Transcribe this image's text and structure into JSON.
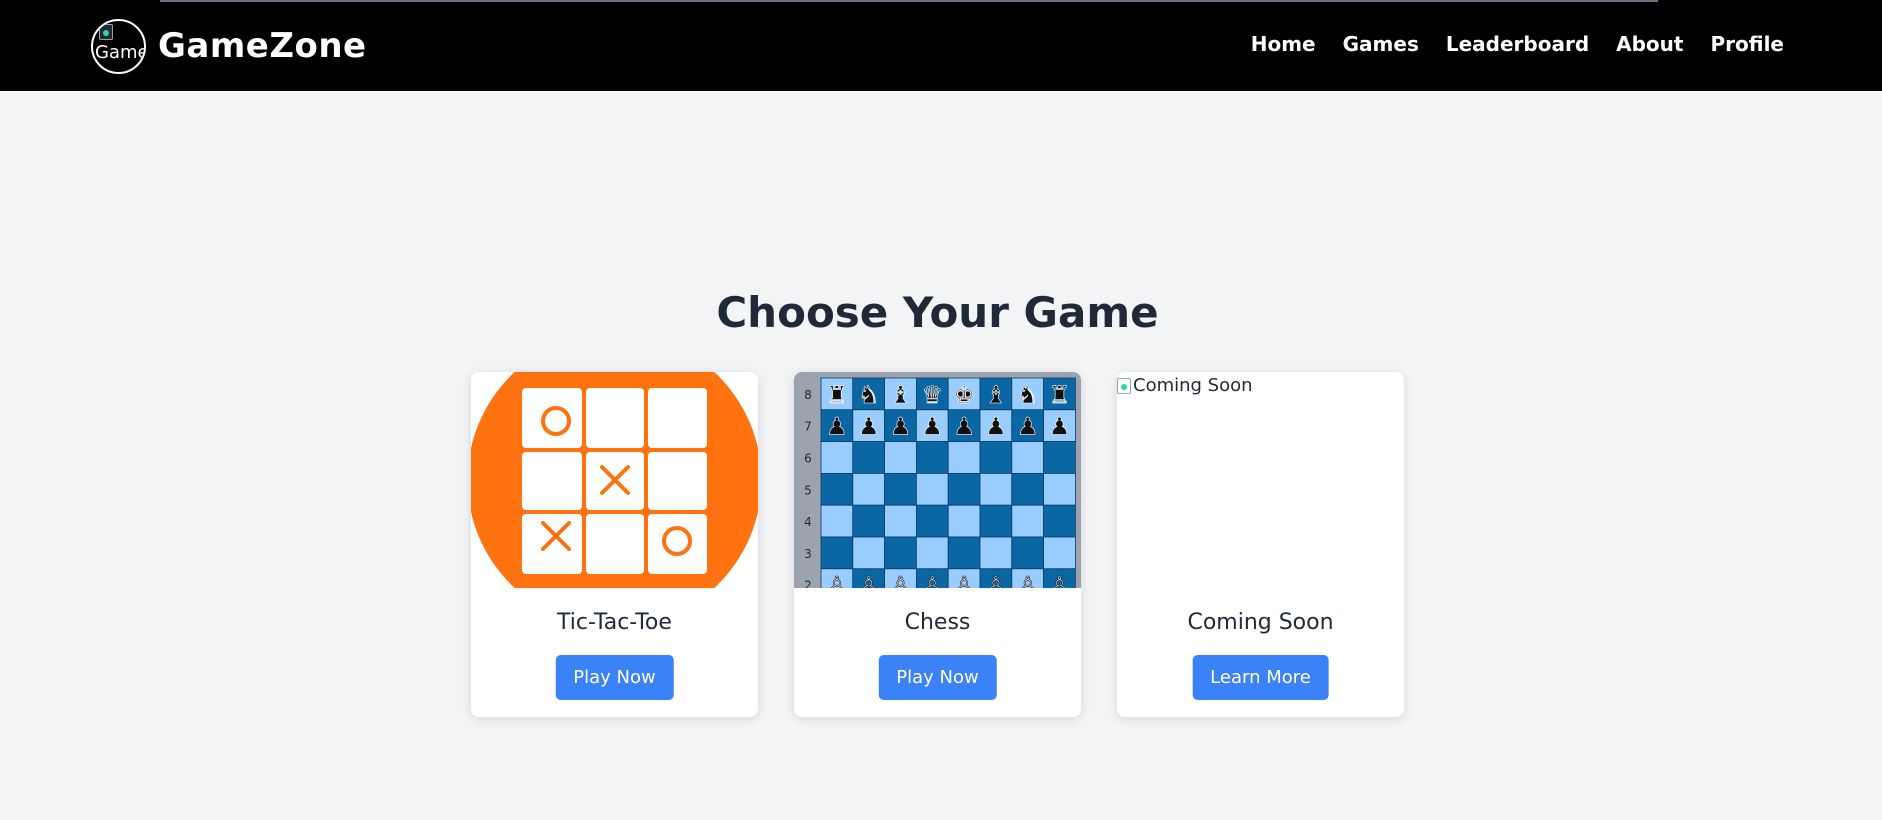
{
  "header": {
    "logo_alt": "Game",
    "brand": "GameZone",
    "nav": [
      "Home",
      "Games",
      "Leaderboard",
      "About",
      "Profile"
    ]
  },
  "main": {
    "heading": "Choose Your Game",
    "cards": [
      {
        "title": "Tic-Tac-Toe",
        "button": "Play Now",
        "image": "tic-tac-toe-board"
      },
      {
        "title": "Chess",
        "button": "Play Now",
        "image": "chess-board",
        "rank_labels": [
          "8",
          "7",
          "6",
          "5",
          "4",
          "3",
          "2"
        ]
      },
      {
        "title": "Coming Soon",
        "button": "Learn More",
        "image_alt": "Coming Soon"
      }
    ]
  },
  "colors": {
    "navbar": "#000000",
    "background": "#f3f4f6",
    "button": "#3b82f6",
    "ttt_orange": "#ff7210",
    "chess_dark": "#0b67a4",
    "chess_light": "#99ccff"
  }
}
